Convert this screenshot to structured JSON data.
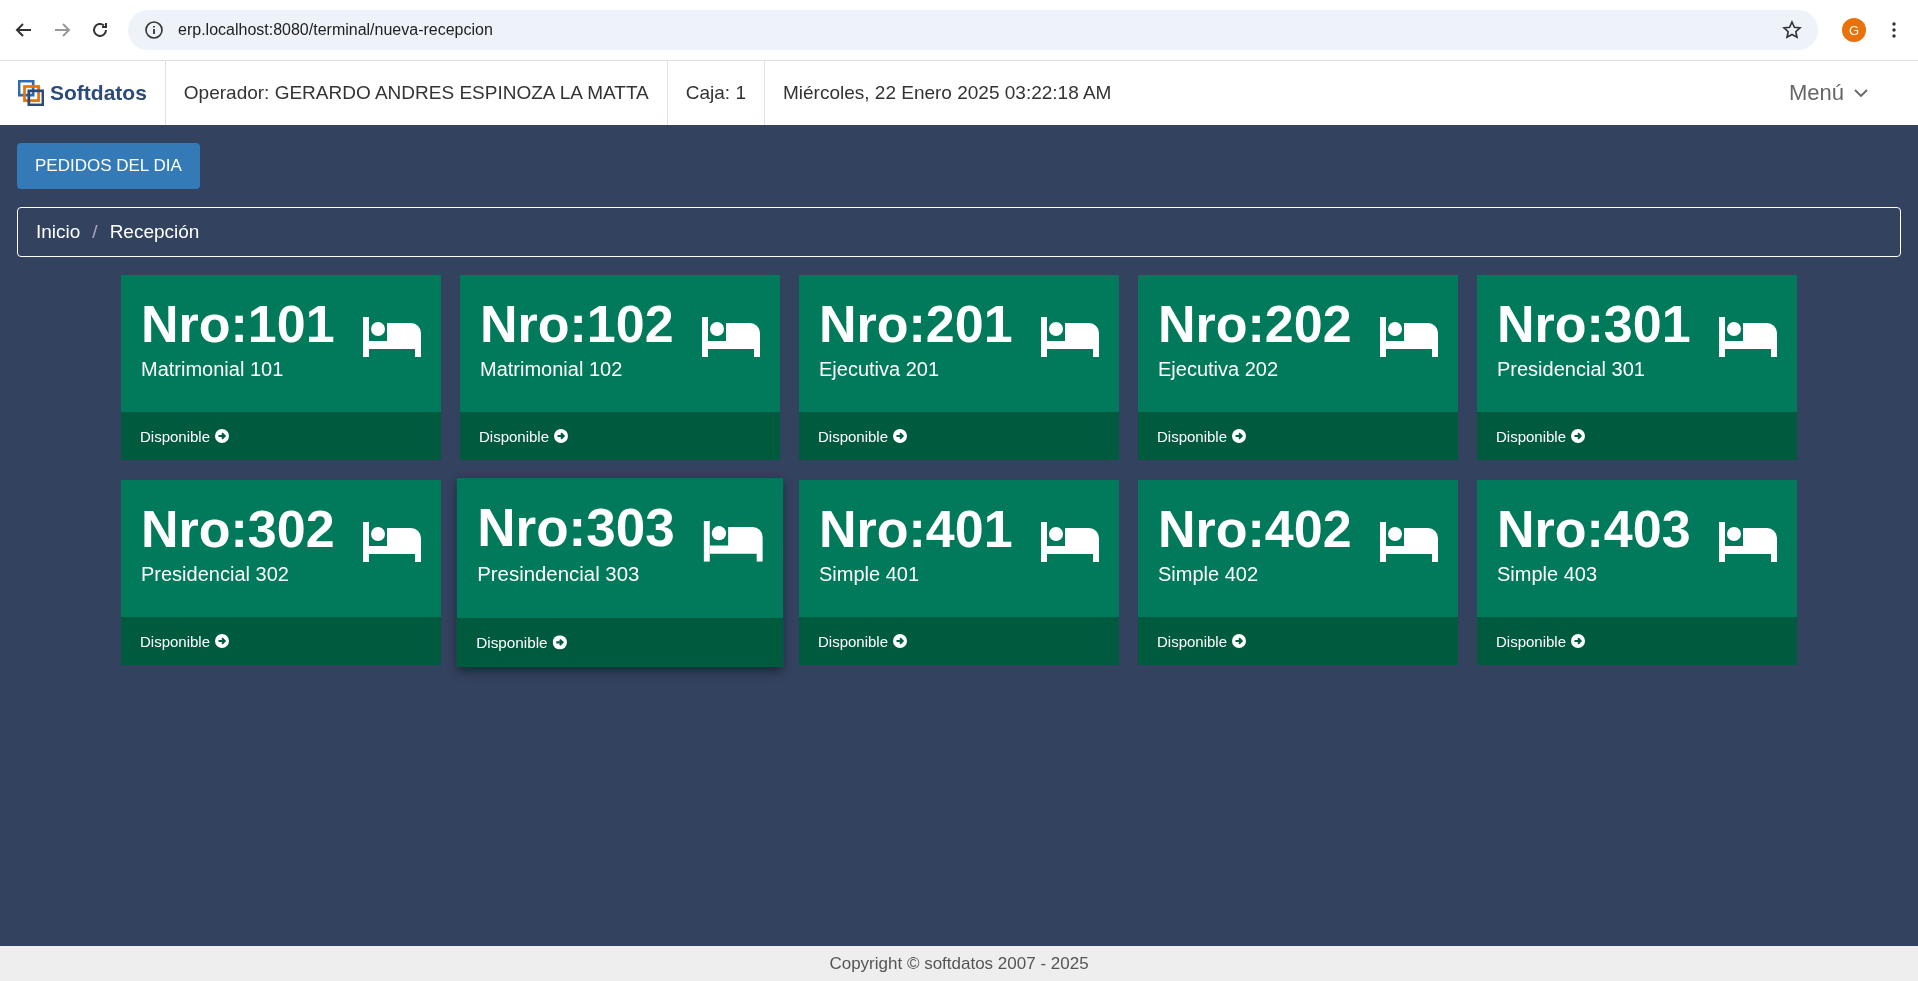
{
  "browser": {
    "url": "erp.localhost:8080/terminal/nueva-recepcion",
    "profile_initial": "G"
  },
  "header": {
    "logo": "Softdatos",
    "operator": "Operador: GERARDO ANDRES ESPINOZA LA MATTA",
    "register": "Caja: 1",
    "datetime": "Miércoles, 22 Enero 2025 03:22:18 AM",
    "menu": "Menú"
  },
  "orders_button": "PEDIDOS DEL DIA",
  "breadcrumb_separator": "/",
  "breadcrumb": [
    {
      "label": "Inicio"
    },
    {
      "label": "Recepción"
    }
  ],
  "rooms": [
    {
      "number": "Nro:101",
      "name": "Matrimonial 101",
      "status": "Disponible",
      "hovered": false
    },
    {
      "number": "Nro:102",
      "name": "Matrimonial 102",
      "status": "Disponible",
      "hovered": false
    },
    {
      "number": "Nro:201",
      "name": "Ejecutiva 201",
      "status": "Disponible",
      "hovered": false
    },
    {
      "number": "Nro:202",
      "name": "Ejecutiva 202",
      "status": "Disponible",
      "hovered": false
    },
    {
      "number": "Nro:301",
      "name": "Presidencial 301",
      "status": "Disponible",
      "hovered": false
    },
    {
      "number": "Nro:302",
      "name": "Presidencial 302",
      "status": "Disponible",
      "hovered": false
    },
    {
      "number": "Nro:303",
      "name": "Presindencial 303",
      "status": "Disponible",
      "hovered": true
    },
    {
      "number": "Nro:401",
      "name": "Simple 401",
      "status": "Disponible",
      "hovered": false
    },
    {
      "number": "Nro:402",
      "name": "Simple 402",
      "status": "Disponible",
      "hovered": false
    },
    {
      "number": "Nro:403",
      "name": "Simple 403",
      "status": "Disponible",
      "hovered": false
    }
  ],
  "footer": "Copyright © softdatos 2007 - 2025"
}
